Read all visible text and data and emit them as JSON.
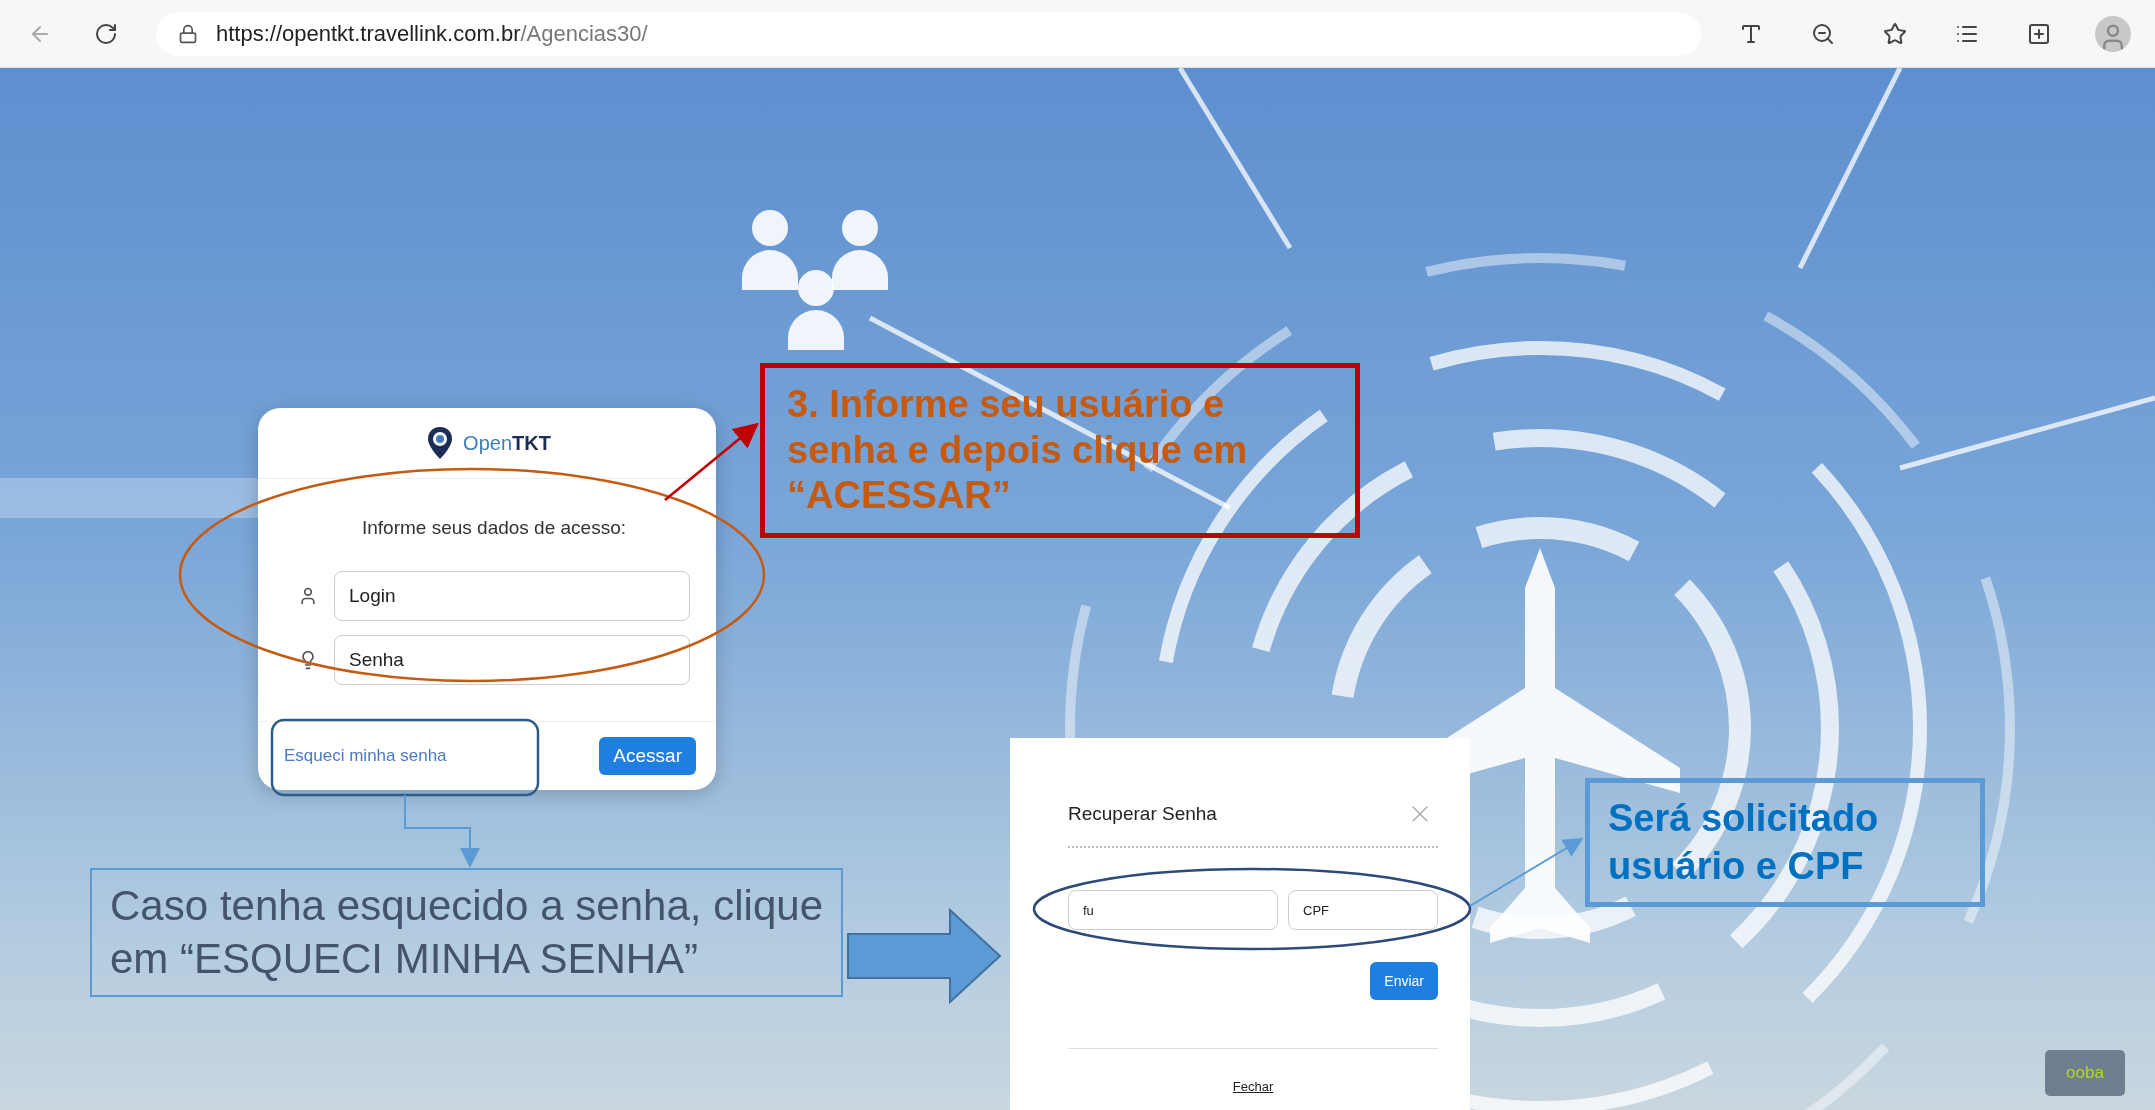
{
  "browser": {
    "url_host": "https://opentkt.travellink.com.br",
    "url_path": "/Agencias30/"
  },
  "login_card": {
    "logo": {
      "light": "Open",
      "bold": "TKT"
    },
    "heading": "Informe seus dados de acesso:",
    "fields": [
      {
        "kind": "user",
        "placeholder": "Login"
      },
      {
        "kind": "key",
        "placeholder": "Senha"
      }
    ],
    "forgot_link": "Esqueci minha senha",
    "submit": "Acessar"
  },
  "recover_modal": {
    "title": "Recuperar Senha",
    "fields": [
      {
        "value": "fu"
      },
      {
        "placeholder": "CPF"
      }
    ],
    "submit": "Enviar",
    "close_link": "Fechar"
  },
  "annotations": [
    {
      "kind": "step",
      "text": "3. Informe seu usuário e senha e depois clique em “ACESSAR”"
    },
    {
      "kind": "caption",
      "text": "Caso tenha esquecido a senha, clique em “ESQUECI MINHA SENHA”"
    },
    {
      "kind": "note",
      "text": "Será solicitado usuário e CPF"
    }
  ],
  "corner_logo": "ooba"
}
